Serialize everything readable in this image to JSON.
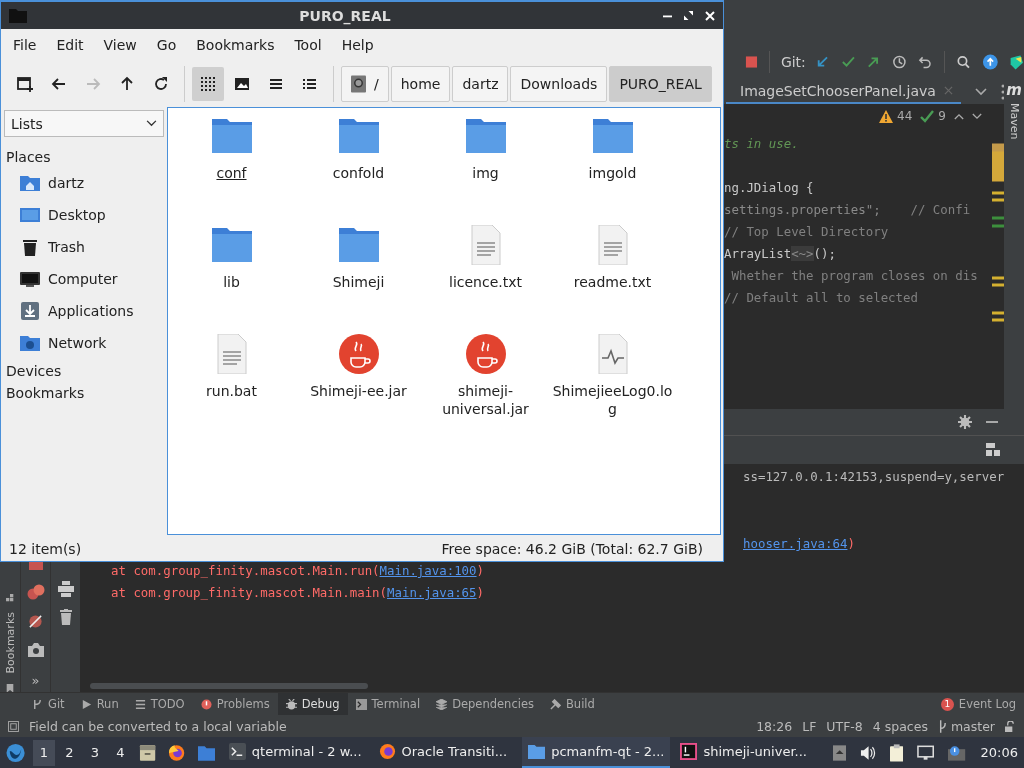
{
  "file_manager": {
    "title": "PURO_REAL",
    "menu": [
      "File",
      "Edit",
      "View",
      "Go",
      "Bookmarks",
      "Tool",
      "Help"
    ],
    "nav_buttons": [
      {
        "kind": "new-tab",
        "disabled": false
      },
      {
        "kind": "back",
        "disabled": false
      },
      {
        "kind": "forward",
        "disabled": true
      },
      {
        "kind": "up",
        "disabled": false
      },
      {
        "kind": "reload",
        "disabled": false
      }
    ],
    "view_modes": [
      {
        "kind": "icons",
        "selected": true
      },
      {
        "kind": "thumbnails",
        "selected": false
      },
      {
        "kind": "compact",
        "selected": false
      },
      {
        "kind": "details",
        "selected": false
      }
    ],
    "path": [
      {
        "kind": "root",
        "label": "/",
        "selected": false
      },
      {
        "kind": "dir",
        "label": "home",
        "selected": false
      },
      {
        "kind": "dir",
        "label": "dartz",
        "selected": false
      },
      {
        "kind": "dir",
        "label": "Downloads",
        "selected": false
      },
      {
        "kind": "dir",
        "label": "PURO_REAL",
        "selected": true
      }
    ],
    "side_pane_mode": "Lists",
    "sections": [
      {
        "title": "Places",
        "items": [
          {
            "kind": "home",
            "label": "dartz"
          },
          {
            "kind": "desktop",
            "label": "Desktop"
          },
          {
            "kind": "trash",
            "label": "Trash"
          },
          {
            "kind": "computer",
            "label": "Computer"
          },
          {
            "kind": "applications",
            "label": "Applications"
          },
          {
            "kind": "network",
            "label": "Network"
          }
        ]
      },
      {
        "title": "Devices"
      },
      {
        "title": "Bookmarks"
      }
    ],
    "files": [
      {
        "kind": "folder",
        "name": "conf",
        "focused": true
      },
      {
        "kind": "folder",
        "name": "confold",
        "focused": false
      },
      {
        "kind": "folder",
        "name": "img",
        "focused": false
      },
      {
        "kind": "folder",
        "name": "imgold",
        "focused": false
      },
      {
        "kind": "folder",
        "name": "lib",
        "focused": false
      },
      {
        "kind": "folder",
        "name": "Shimeji",
        "focused": false
      },
      {
        "kind": "text",
        "name": "licence.txt",
        "focused": false
      },
      {
        "kind": "text",
        "name": "readme.txt",
        "focused": false
      },
      {
        "kind": "text",
        "name": "run.bat",
        "focused": false
      },
      {
        "kind": "java",
        "name": "Shimeji-ee.jar",
        "focused": false
      },
      {
        "kind": "java",
        "name": "shimeji-universal.jar",
        "focused": false
      },
      {
        "kind": "log",
        "name": "ShimejieeLog0.log",
        "focused": false
      }
    ],
    "status_left": "12 item(s)",
    "status_right": "Free space: 46.2 GiB (Total: 62.7 GiB)"
  },
  "ide": {
    "vcs_label": "Git:",
    "editor_tab": "ImageSetChooserPanel.java",
    "warnings": "44",
    "weak_warnings": "9",
    "side_tool": "Maven",
    "side_tool_letter": "m",
    "more_tools": "»",
    "code_lines": [
      [
        {
          "kind": "doc",
          "text": "ts in use."
        }
      ],
      [
        {
          "kind": "plain",
          "text": "ng.JDialog {"
        }
      ],
      [
        {
          "kind": "string",
          "text": "settings.properties\";"
        },
        {
          "kind": "comment",
          "text": "    // Confi"
        }
      ],
      [
        {
          "kind": "comment",
          "text": "// Top Level Directory"
        }
      ],
      [
        {
          "kind": "plain",
          "text": "ArrayList"
        },
        {
          "kind": "fold",
          "text": "<~>"
        },
        {
          "kind": "plain",
          "text": "();"
        }
      ],
      [
        {
          "kind": "comment",
          "text": " Whether the program closes on dis"
        }
      ],
      [
        {
          "kind": "comment",
          "text": "// Default all to selected"
        }
      ]
    ],
    "console_lines": [
      [
        {
          "kind": "text",
          "text": "ss=127.0.0.1:42153,suspend=y,server"
        }
      ],
      [
        {
          "kind": "link",
          "text": "hooser.java:64"
        },
        {
          "kind": "error",
          "text": ")"
        }
      ],
      [
        {
          "kind": "error",
          "text": "at com.group_finity.mascot.Main.run("
        },
        {
          "kind": "link",
          "text": "Main.java:100"
        },
        {
          "kind": "error",
          "text": ")"
        }
      ],
      [
        {
          "kind": "error",
          "text": "at com.group_finity.mascot.Main.main("
        },
        {
          "kind": "link",
          "text": "Main.java:65"
        },
        {
          "kind": "error",
          "text": ")"
        }
      ]
    ],
    "left_stripe_tool": "Bookmarks",
    "tool_windows": [
      {
        "kind": "git",
        "label": "Git",
        "selected": false
      },
      {
        "kind": "run",
        "label": "Run",
        "selected": false
      },
      {
        "kind": "todo",
        "label": "TODO",
        "selected": false
      },
      {
        "kind": "problems",
        "label": "Problems",
        "selected": false
      },
      {
        "kind": "debug",
        "label": "Debug",
        "selected": true
      },
      {
        "kind": "terminal",
        "label": "Terminal",
        "selected": false
      },
      {
        "kind": "dependencies",
        "label": "Dependencies",
        "selected": false
      },
      {
        "kind": "build",
        "label": "Build",
        "selected": false
      }
    ],
    "event_log": {
      "count": "1",
      "label": "Event Log"
    },
    "status_message": "Field can be converted to a local variable",
    "status_items": [
      "18:26",
      "LF",
      "UTF-8",
      "4 spaces"
    ],
    "branch": "master"
  },
  "taskbar": {
    "desktops": [
      {
        "label": "1",
        "selected": true
      },
      {
        "label": "2",
        "selected": false
      },
      {
        "label": "3",
        "selected": false
      },
      {
        "label": "4",
        "selected": false
      }
    ],
    "tasks": [
      {
        "kind": "terminal",
        "label": "qterminal - 2 w...",
        "selected": false
      },
      {
        "kind": "firefox",
        "label": "Oracle Transiti...",
        "selected": false
      },
      {
        "kind": "folder",
        "label": "pcmanfm-qt - 2...",
        "selected": true
      },
      {
        "kind": "ide",
        "label": "shimeji-univer...",
        "selected": false
      }
    ],
    "clock": "20:06"
  }
}
